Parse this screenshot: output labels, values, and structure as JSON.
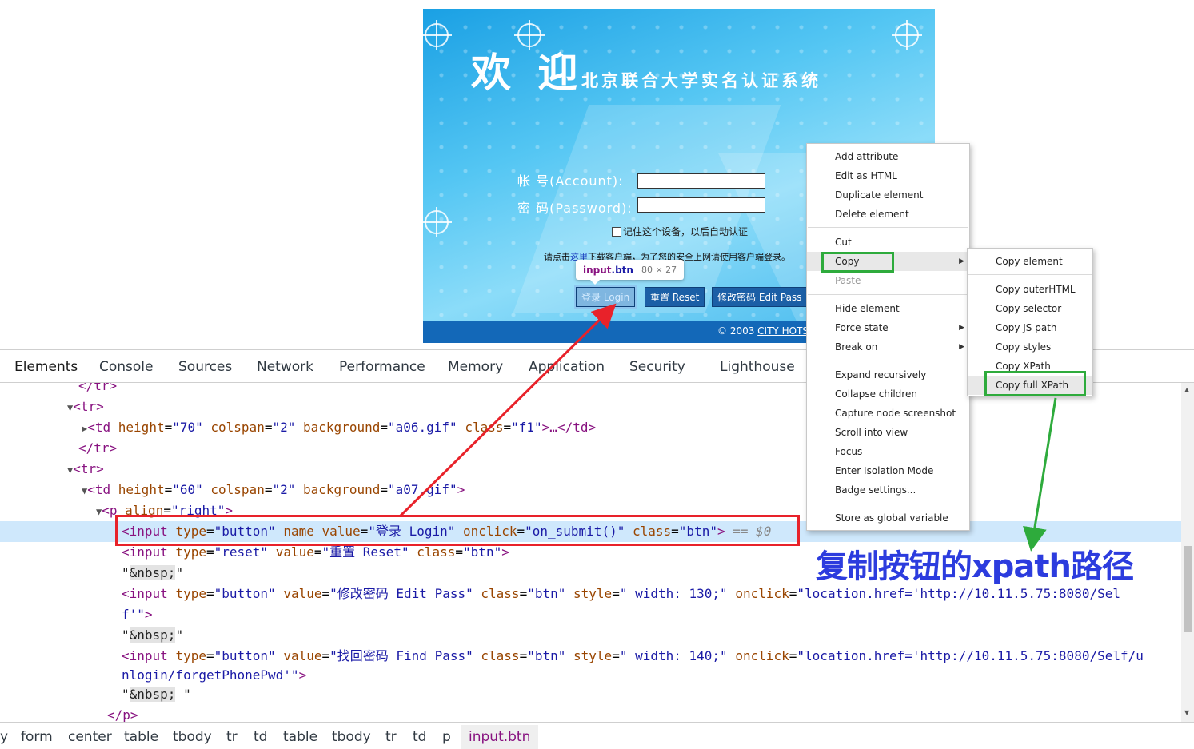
{
  "login_page": {
    "welcome": "欢 迎",
    "system_name": "北京联合大学实名认证系统",
    "account_label": "帐  号(Account):",
    "password_label": "密  码(Password):",
    "remember_label": "记住这个设备，以后自动认证",
    "hint_prefix": "请点击",
    "hint_link": "这里",
    "hint_suffix": "下载客户端，为了您的安全上网请使用客户端登录。",
    "login_button": "登录 Login",
    "reset_button": "重置 Reset",
    "edit_pass_button": "修改密码 Edit Pass",
    "copyright_prefix": "© 2003 ",
    "copyright_link": "CITY HOTS"
  },
  "tooltip": {
    "tag": "input",
    "selector": ".btn",
    "dimensions": "80 × 27"
  },
  "devtools": {
    "tabs": [
      "Elements",
      "Console",
      "Sources",
      "Network",
      "Performance",
      "Memory",
      "Application",
      "Security",
      "Lighthouse"
    ],
    "active_tab": "Elements"
  },
  "code": {
    "l0": {
      "text": "</tr>"
    },
    "l1": {
      "tag": "tr"
    },
    "l2": {
      "tag": "td",
      "a1": "height",
      "v1": "\"70\"",
      "a2": "colspan",
      "v2": "\"2\"",
      "a3": "background",
      "v3": "\"a06.gif\"",
      "a4": "class",
      "v4": "\"f1\"",
      "ellipsis": ">…</td>"
    },
    "l3": {
      "text": "</tr>"
    },
    "l4": {
      "tag": "tr"
    },
    "l5": {
      "tag": "td",
      "a1": "height",
      "v1": "\"60\"",
      "a2": "colspan",
      "v2": "\"2\"",
      "a3": "background",
      "v3": "\"a07.gif\""
    },
    "l6": {
      "tag": "p",
      "a1": "align",
      "v1": "\"right\""
    },
    "l7": {
      "tag": "input",
      "a1": "type",
      "v1": "\"button\"",
      "a2": "name",
      "a3": "value",
      "v3": "\"登录 Login\"",
      "a4": "onclick",
      "v4": "\"on_submit()\"",
      "a5": "class",
      "v5": "\"btn\"",
      "marker": "== $0"
    },
    "l8": {
      "tag": "input",
      "a1": "type",
      "v1": "\"reset\"",
      "a2": "value",
      "v2": "\"重置 Reset\"",
      "a3": "class",
      "v3": "\"btn\""
    },
    "l9": {
      "nbsp": "&nbsp;"
    },
    "l10": {
      "tag": "input",
      "a1": "type",
      "v1": "\"button\"",
      "a2": "value",
      "v2": "\"修改密码 Edit Pass\"",
      "a3": "class",
      "v3": "\"btn\"",
      "a4": "style",
      "v4": "\" width: 130;\"",
      "a5": "onclick",
      "v5": "\"location.href='http://10.11.5.75:8080/Sel"
    },
    "l11": {
      "text": "f'\""
    },
    "l12": {
      "nbsp": "&nbsp;"
    },
    "l13": {
      "tag": "input",
      "a1": "type",
      "v1": "\"button\"",
      "a2": "value",
      "v2": "\"找回密码 Find Pass\"",
      "a3": "class",
      "v3": "\"btn\"",
      "a4": "style",
      "v4": "\" width: 140;\"",
      "a5": "onclick",
      "v5": "\"location.href='http://10.11.5.75:8080/Self/u"
    },
    "l14": {
      "text": "nlogin/forgetPhonePwd'\""
    },
    "l15": {
      "nbsp": "&nbsp;",
      "tail": " \""
    },
    "l16": {
      "text": "</p>"
    }
  },
  "breadcrumb": [
    "y",
    "form",
    "center",
    "table",
    "tbody",
    "tr",
    "td",
    "table",
    "tbody",
    "tr",
    "td",
    "p",
    "input.btn"
  ],
  "context_menu": {
    "items": [
      "Add attribute",
      "Edit as HTML",
      "Duplicate element",
      "Delete element",
      "Cut",
      "Copy",
      "Paste",
      "Hide element",
      "Force state",
      "Break on",
      "Expand recursively",
      "Collapse children",
      "Capture node screenshot",
      "Scroll into view",
      "Focus",
      "Enter Isolation Mode",
      "Badge settings...",
      "Store as global variable"
    ]
  },
  "copy_submenu": {
    "items": [
      "Copy element",
      "Copy outerHTML",
      "Copy selector",
      "Copy JS path",
      "Copy styles",
      "Copy XPath",
      "Copy full XPath"
    ]
  },
  "annotation": {
    "caption": "复制按钮的xpath路径",
    "highlight_color": "#e8222a",
    "menu_highlight_color": "#2eab3c",
    "caption_color": "#2c3cde"
  }
}
